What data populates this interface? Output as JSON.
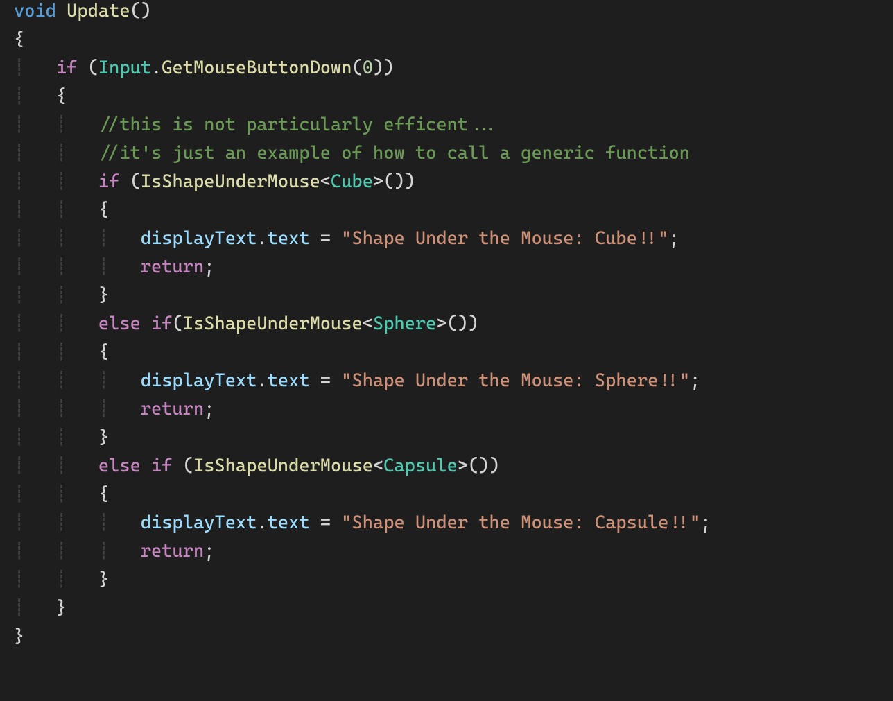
{
  "code": {
    "kw_void": "void",
    "fn_update": "Update",
    "ctl_if": "if",
    "ctl_else": "else",
    "ctl_return": "return",
    "cls_Input": "Input",
    "fn_GetMouseButtonDown": "GetMouseButtonDown",
    "num_zero": "0",
    "comment1": "//this is not particularly efficent...",
    "comment2": "//it's just an example of how to call a generic function",
    "fn_IsShapeUnderMouse": "IsShapeUnderMouse",
    "cls_Cube": "Cube",
    "cls_Sphere": "Sphere",
    "cls_Capsule": "Capsule",
    "mem_displayText": "displayText",
    "mem_text": "text",
    "str_cube": "\"Shape Under the Mouse: Cube!!\"",
    "str_sphere": "\"Shape Under the Mouse: Sphere!!\"",
    "str_capsule": "\"Shape Under the Mouse: Capsule!!\"",
    "brace_open": "{",
    "brace_close": "}",
    "paren_open": "(",
    "paren_close": ")",
    "angle_open": "<",
    "angle_close": ">",
    "dot": ".",
    "eq": " = ",
    "semi": ";",
    "empty_parens": "()"
  }
}
